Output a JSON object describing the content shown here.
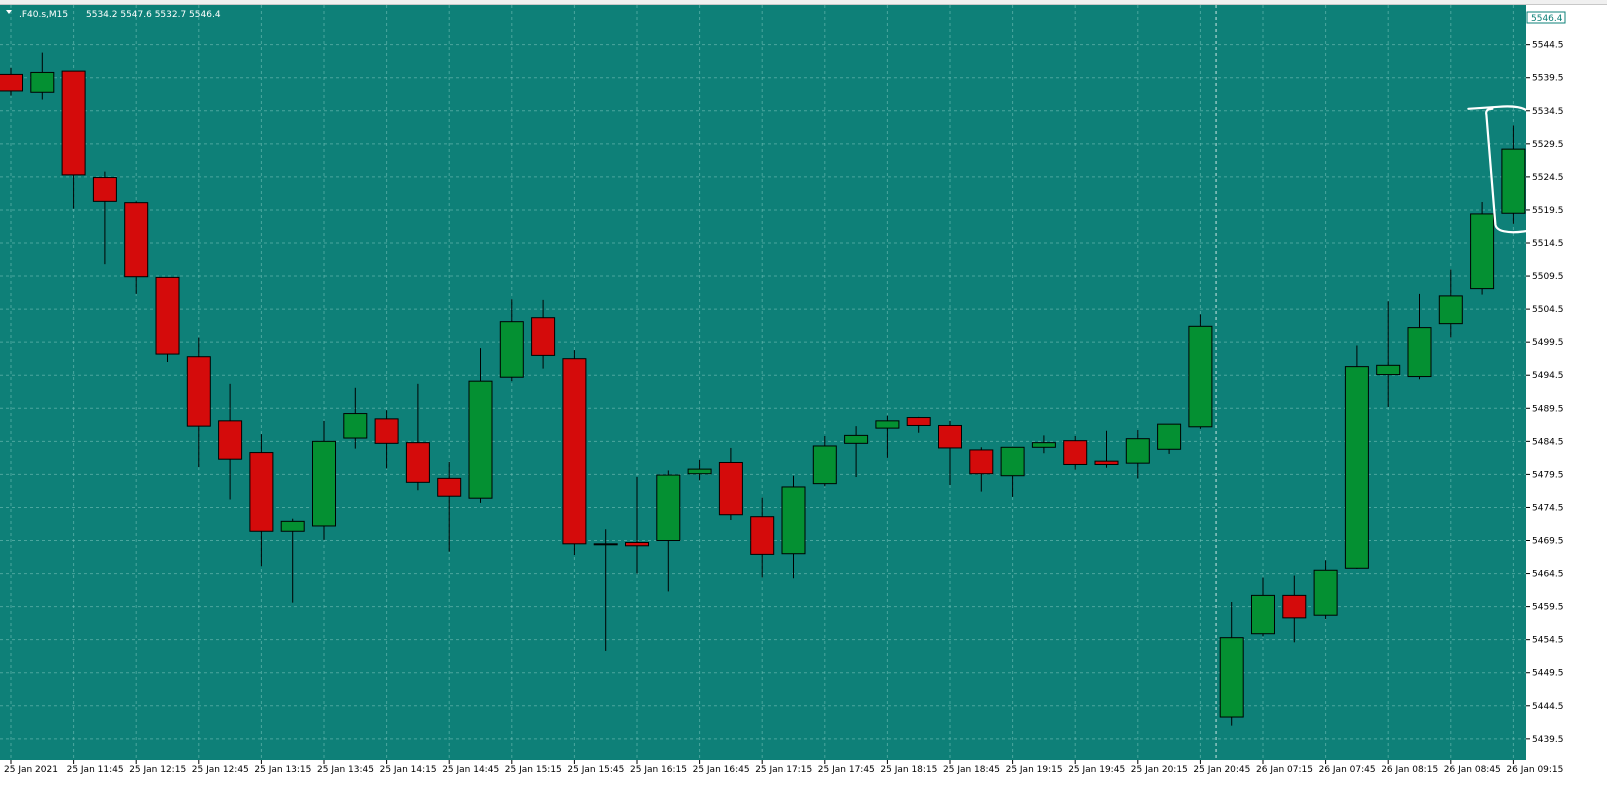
{
  "header": {
    "symbol": ".F40.s,M15",
    "ohlc": "5534.2 5547.6 5532.7 5546.4"
  },
  "current_price_label": "5546.4",
  "colors": {
    "background": "#0e8078",
    "grid": "#7ec4bd",
    "bull": "#049032",
    "bear": "#d40b0b",
    "axis_bg": "#ffffff",
    "annotation": "#ffffff"
  },
  "chart_data": {
    "type": "candlestick",
    "ylim": [
      5436.3,
      5550.5
    ],
    "y_ticks": [
      "5544.5",
      "5539.5",
      "5534.5",
      "5529.5",
      "5524.5",
      "5519.5",
      "5514.5",
      "5509.5",
      "5504.5",
      "5499.5",
      "5494.5",
      "5489.5",
      "5484.5",
      "5479.5",
      "5474.5",
      "5469.5",
      "5464.5",
      "5459.5",
      "5454.5",
      "5449.5",
      "5444.5",
      "5439.5"
    ],
    "x_labels": [
      {
        "candle": 0,
        "text": "25 Jan 2021"
      },
      {
        "candle": 2,
        "text": "25 Jan 11:45"
      },
      {
        "candle": 4,
        "text": "25 Jan 12:15"
      },
      {
        "candle": 6,
        "text": "25 Jan 12:45"
      },
      {
        "candle": 8,
        "text": "25 Jan 13:15"
      },
      {
        "candle": 10,
        "text": "25 Jan 13:45"
      },
      {
        "candle": 12,
        "text": "25 Jan 14:15"
      },
      {
        "candle": 14,
        "text": "25 Jan 14:45"
      },
      {
        "candle": 16,
        "text": "25 Jan 15:15"
      },
      {
        "candle": 18,
        "text": "25 Jan 15:45"
      },
      {
        "candle": 20,
        "text": "25 Jan 16:15"
      },
      {
        "candle": 22,
        "text": "25 Jan 16:45"
      },
      {
        "candle": 24,
        "text": "25 Jan 17:15"
      },
      {
        "candle": 26,
        "text": "25 Jan 17:45"
      },
      {
        "candle": 28,
        "text": "25 Jan 18:15"
      },
      {
        "candle": 30,
        "text": "25 Jan 18:45"
      },
      {
        "candle": 32,
        "text": "25 Jan 19:15"
      },
      {
        "candle": 34,
        "text": "25 Jan 19:45"
      },
      {
        "candle": 36,
        "text": "25 Jan 20:15"
      },
      {
        "candle": 38,
        "text": "25 Jan 20:45"
      },
      {
        "candle": 40,
        "text": "26 Jan 07:15"
      },
      {
        "candle": 42,
        "text": "26 Jan 07:45"
      },
      {
        "candle": 44,
        "text": "26 Jan 08:15"
      },
      {
        "candle": 46,
        "text": "26 Jan 08:45"
      },
      {
        "candle": 48,
        "text": "26 Jan 09:15"
      }
    ],
    "session_break_after_candle": 38,
    "candles": [
      {
        "o": 5540.0,
        "h": 5541.0,
        "l": 5536.8,
        "c": 5537.5
      },
      {
        "o": 5537.3,
        "h": 5543.3,
        "l": 5536.2,
        "c": 5540.3
      },
      {
        "o": 5540.5,
        "h": 5540.5,
        "l": 5519.7,
        "c": 5524.8
      },
      {
        "o": 5524.4,
        "h": 5525.3,
        "l": 5511.3,
        "c": 5520.8
      },
      {
        "o": 5520.6,
        "h": 5520.8,
        "l": 5506.8,
        "c": 5509.4
      },
      {
        "o": 5509.3,
        "h": 5509.3,
        "l": 5496.5,
        "c": 5497.7
      },
      {
        "o": 5497.3,
        "h": 5500.2,
        "l": 5480.6,
        "c": 5486.8
      },
      {
        "o": 5487.6,
        "h": 5493.2,
        "l": 5475.7,
        "c": 5481.8
      },
      {
        "o": 5482.8,
        "h": 5485.6,
        "l": 5465.6,
        "c": 5470.9
      },
      {
        "o": 5470.9,
        "h": 5472.8,
        "l": 5460.1,
        "c": 5472.4
      },
      {
        "o": 5471.7,
        "h": 5487.6,
        "l": 5469.6,
        "c": 5484.5
      },
      {
        "o": 5485.0,
        "h": 5492.6,
        "l": 5483.4,
        "c": 5488.7
      },
      {
        "o": 5487.9,
        "h": 5489.2,
        "l": 5480.4,
        "c": 5484.2
      },
      {
        "o": 5484.3,
        "h": 5493.2,
        "l": 5477.1,
        "c": 5478.3
      },
      {
        "o": 5478.9,
        "h": 5481.4,
        "l": 5467.8,
        "c": 5476.2
      },
      {
        "o": 5475.9,
        "h": 5498.6,
        "l": 5475.2,
        "c": 5493.6
      },
      {
        "o": 5494.2,
        "h": 5506.0,
        "l": 5493.6,
        "c": 5502.6
      },
      {
        "o": 5503.2,
        "h": 5505.9,
        "l": 5495.5,
        "c": 5497.5
      },
      {
        "o": 5497.0,
        "h": 5498.3,
        "l": 5467.3,
        "c": 5469.0
      },
      {
        "o": 5469.0,
        "h": 5471.2,
        "l": 5452.8,
        "c": 5469.0
      },
      {
        "o": 5469.2,
        "h": 5479.1,
        "l": 5464.5,
        "c": 5468.7
      },
      {
        "o": 5469.5,
        "h": 5480.1,
        "l": 5461.8,
        "c": 5479.4
      },
      {
        "o": 5479.6,
        "h": 5481.7,
        "l": 5478.6,
        "c": 5480.3
      },
      {
        "o": 5481.3,
        "h": 5483.5,
        "l": 5472.6,
        "c": 5473.4
      },
      {
        "o": 5473.1,
        "h": 5476.0,
        "l": 5463.9,
        "c": 5467.4
      },
      {
        "o": 5467.5,
        "h": 5479.3,
        "l": 5463.8,
        "c": 5477.6
      },
      {
        "o": 5478.1,
        "h": 5485.3,
        "l": 5477.7,
        "c": 5483.8
      },
      {
        "o": 5484.2,
        "h": 5486.8,
        "l": 5479.1,
        "c": 5485.4
      },
      {
        "o": 5486.5,
        "h": 5488.4,
        "l": 5482.0,
        "c": 5487.6
      },
      {
        "o": 5488.1,
        "h": 5488.2,
        "l": 5485.8,
        "c": 5486.9
      },
      {
        "o": 5486.9,
        "h": 5487.6,
        "l": 5477.9,
        "c": 5483.5
      },
      {
        "o": 5483.2,
        "h": 5483.6,
        "l": 5476.9,
        "c": 5479.6
      },
      {
        "o": 5479.3,
        "h": 5483.4,
        "l": 5476.1,
        "c": 5483.6
      },
      {
        "o": 5483.6,
        "h": 5485.4,
        "l": 5482.7,
        "c": 5484.3
      },
      {
        "o": 5484.6,
        "h": 5485.3,
        "l": 5480.2,
        "c": 5481.0
      },
      {
        "o": 5481.5,
        "h": 5486.1,
        "l": 5480.5,
        "c": 5481.0
      },
      {
        "o": 5481.2,
        "h": 5486.2,
        "l": 5478.9,
        "c": 5484.9
      },
      {
        "o": 5483.3,
        "h": 5485.1,
        "l": 5482.6,
        "c": 5487.1
      },
      {
        "o": 5486.7,
        "h": 5503.7,
        "l": 5486.4,
        "c": 5501.9
      },
      {
        "o": 5442.8,
        "h": 5460.2,
        "l": 5441.5,
        "c": 5454.8
      },
      {
        "o": 5455.4,
        "h": 5463.9,
        "l": 5455.0,
        "c": 5461.2
      },
      {
        "o": 5461.2,
        "h": 5464.2,
        "l": 5454.1,
        "c": 5457.8
      },
      {
        "o": 5458.2,
        "h": 5466.5,
        "l": 5457.6,
        "c": 5465.0
      },
      {
        "o": 5465.3,
        "h": 5499.0,
        "l": 5465.2,
        "c": 5495.8
      },
      {
        "o": 5494.6,
        "h": 5505.7,
        "l": 5489.7,
        "c": 5496.0
      },
      {
        "o": 5494.3,
        "h": 5506.8,
        "l": 5493.9,
        "c": 5501.7
      },
      {
        "o": 5502.3,
        "h": 5510.5,
        "l": 5500.2,
        "c": 5506.5
      },
      {
        "o": 5507.6,
        "h": 5520.7,
        "l": 5506.7,
        "c": 5518.9
      },
      {
        "o": 5519.0,
        "h": 5532.3,
        "l": 5517.4,
        "c": 5528.7
      }
    ]
  }
}
